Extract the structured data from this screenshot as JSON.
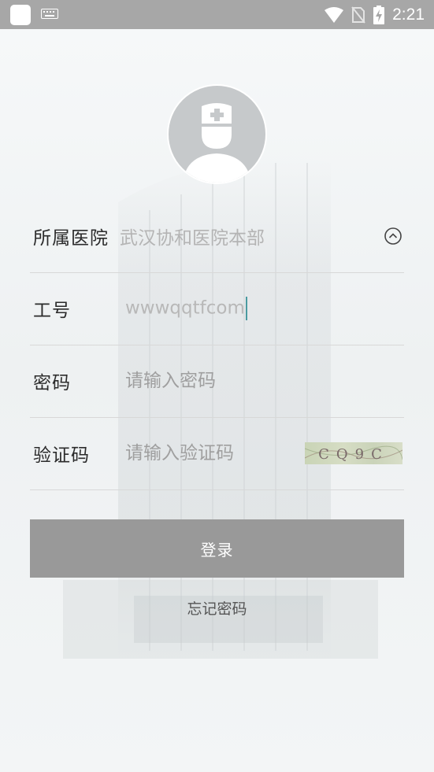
{
  "status_bar": {
    "time": "2:21",
    "icons": [
      "app-icon",
      "keyboard-icon",
      "wifi-icon",
      "no-sim-icon",
      "battery-charging-icon"
    ]
  },
  "login_form": {
    "hospital": {
      "label": "所属医院",
      "value": "武汉协和医院本部",
      "icon": "chevron-up-circle-icon"
    },
    "employee_id": {
      "label": "工号",
      "value": "wwwqqtfcom"
    },
    "password": {
      "label": "密码",
      "placeholder": "请输入密码"
    },
    "captcha": {
      "label": "验证码",
      "placeholder": "请输入验证码",
      "image_text": "CQ9C"
    },
    "login_button": "登录",
    "forgot_password": "忘记密码"
  },
  "colors": {
    "status_bar_bg": "#a7a7a7",
    "button_bg": "#999999",
    "caret": "#4a9aa0",
    "avatar_bg": "#c6c9cb"
  }
}
